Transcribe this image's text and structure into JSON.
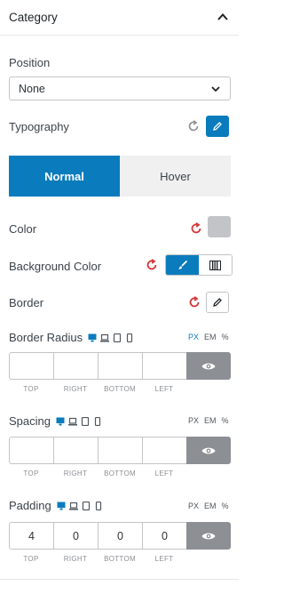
{
  "section": {
    "title": "Category"
  },
  "position": {
    "label": "Position",
    "value": "None"
  },
  "typography": {
    "label": "Typography"
  },
  "tabs": [
    {
      "label": "Normal",
      "active": true
    },
    {
      "label": "Hover",
      "active": false
    }
  ],
  "color": {
    "label": "Color",
    "swatch": "#c3c4c7"
  },
  "background_color": {
    "label": "Background Color"
  },
  "border": {
    "label": "Border"
  },
  "border_radius": {
    "label": "Border Radius",
    "units": [
      "PX",
      "EM",
      "%"
    ],
    "values": [
      "",
      "",
      "",
      ""
    ],
    "sides": [
      "TOP",
      "RIGHT",
      "BOTTOM",
      "LEFT"
    ]
  },
  "spacing": {
    "label": "Spacing",
    "units": [
      "PX",
      "EM",
      "%"
    ],
    "values": [
      "",
      "",
      "",
      ""
    ],
    "sides": [
      "TOP",
      "RIGHT",
      "BOTTOM",
      "LEFT"
    ]
  },
  "padding": {
    "label": "Padding",
    "units": [
      "PX",
      "EM",
      "%"
    ],
    "values": [
      "4",
      "0",
      "0",
      "0"
    ],
    "sides": [
      "TOP",
      "RIGHT",
      "BOTTOM",
      "LEFT"
    ]
  },
  "colors": {
    "accent": "#0a7cbd",
    "reset_red": "#d63638",
    "reset_gray": "#8c8f94"
  },
  "icons": [
    "chevron-up-icon",
    "chevron-down-icon",
    "reset-icon",
    "pencil-icon",
    "brush-icon",
    "gradient-icon",
    "desktop-icon",
    "laptop-icon",
    "tablet-icon",
    "mobile-icon",
    "eye-icon"
  ]
}
